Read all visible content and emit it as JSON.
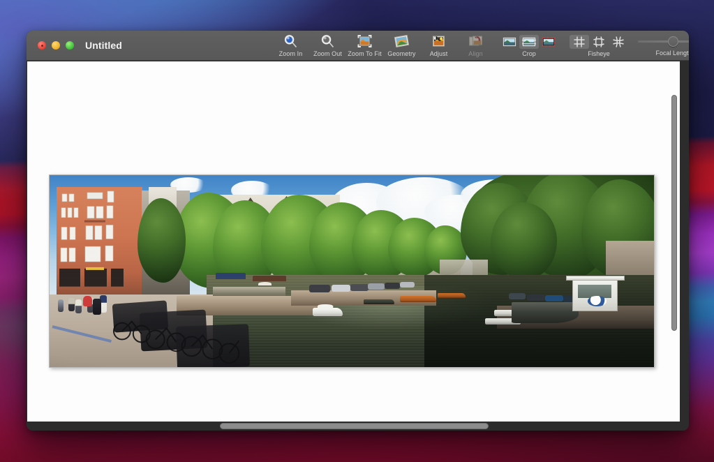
{
  "window": {
    "title": "Untitled",
    "traffic_lights": [
      {
        "name": "close",
        "color": "#e8463c"
      },
      {
        "name": "minimize",
        "color": "#f0b42c"
      },
      {
        "name": "maximize",
        "color": "#43c53b"
      }
    ]
  },
  "toolbar": {
    "items": [
      {
        "id": "zoom-in",
        "label": "Zoom In",
        "icon": "magnifier-plus-icon",
        "enabled": true
      },
      {
        "id": "zoom-out",
        "label": "Zoom Out",
        "icon": "magnifier-minus-icon",
        "enabled": true
      },
      {
        "id": "zoom-to-fit",
        "label": "Zoom To Fit",
        "icon": "fit-image-icon",
        "enabled": true
      },
      {
        "id": "geometry",
        "label": "Geometry",
        "icon": "geometry-photo-icon",
        "enabled": true
      },
      {
        "id": "adjust",
        "label": "Adjust",
        "icon": "adjust-photo-icon",
        "enabled": true
      },
      {
        "id": "align",
        "label": "Align",
        "icon": "align-photo-icon",
        "enabled": false
      }
    ],
    "crop_group": {
      "label": "Crop",
      "segments": [
        {
          "id": "crop-none",
          "icon": "crop-none-icon",
          "selected": false
        },
        {
          "id": "crop-auto",
          "icon": "crop-auto-icon",
          "selected": true
        },
        {
          "id": "crop-manual",
          "icon": "crop-manual-icon",
          "selected": false
        }
      ]
    },
    "fisheye_group": {
      "label": "Fisheye",
      "segments": [
        {
          "id": "fisheye-grid",
          "icon": "grid-hash-icon",
          "selected": true
        },
        {
          "id": "fisheye-barrel",
          "icon": "grid-barrel-icon",
          "selected": false
        },
        {
          "id": "fisheye-pin",
          "icon": "grid-pincushion-icon",
          "selected": false
        }
      ]
    },
    "focal_length": {
      "label": "Focal Length",
      "value_percent": 44
    }
  },
  "document": {
    "image_name": "amsterdam-canal-panorama",
    "description": "Panoramic photograph of an Amsterdam canal with brick townhouses, leafy trees, parked bicycles, moored boats and a white kiosk."
  },
  "scrollbars": {
    "vertical": {
      "name": "vertical-scrollbar",
      "thumb_percent": 64
    },
    "horizontal": {
      "name": "horizontal-scrollbar",
      "thumb_percent": 41
    }
  }
}
